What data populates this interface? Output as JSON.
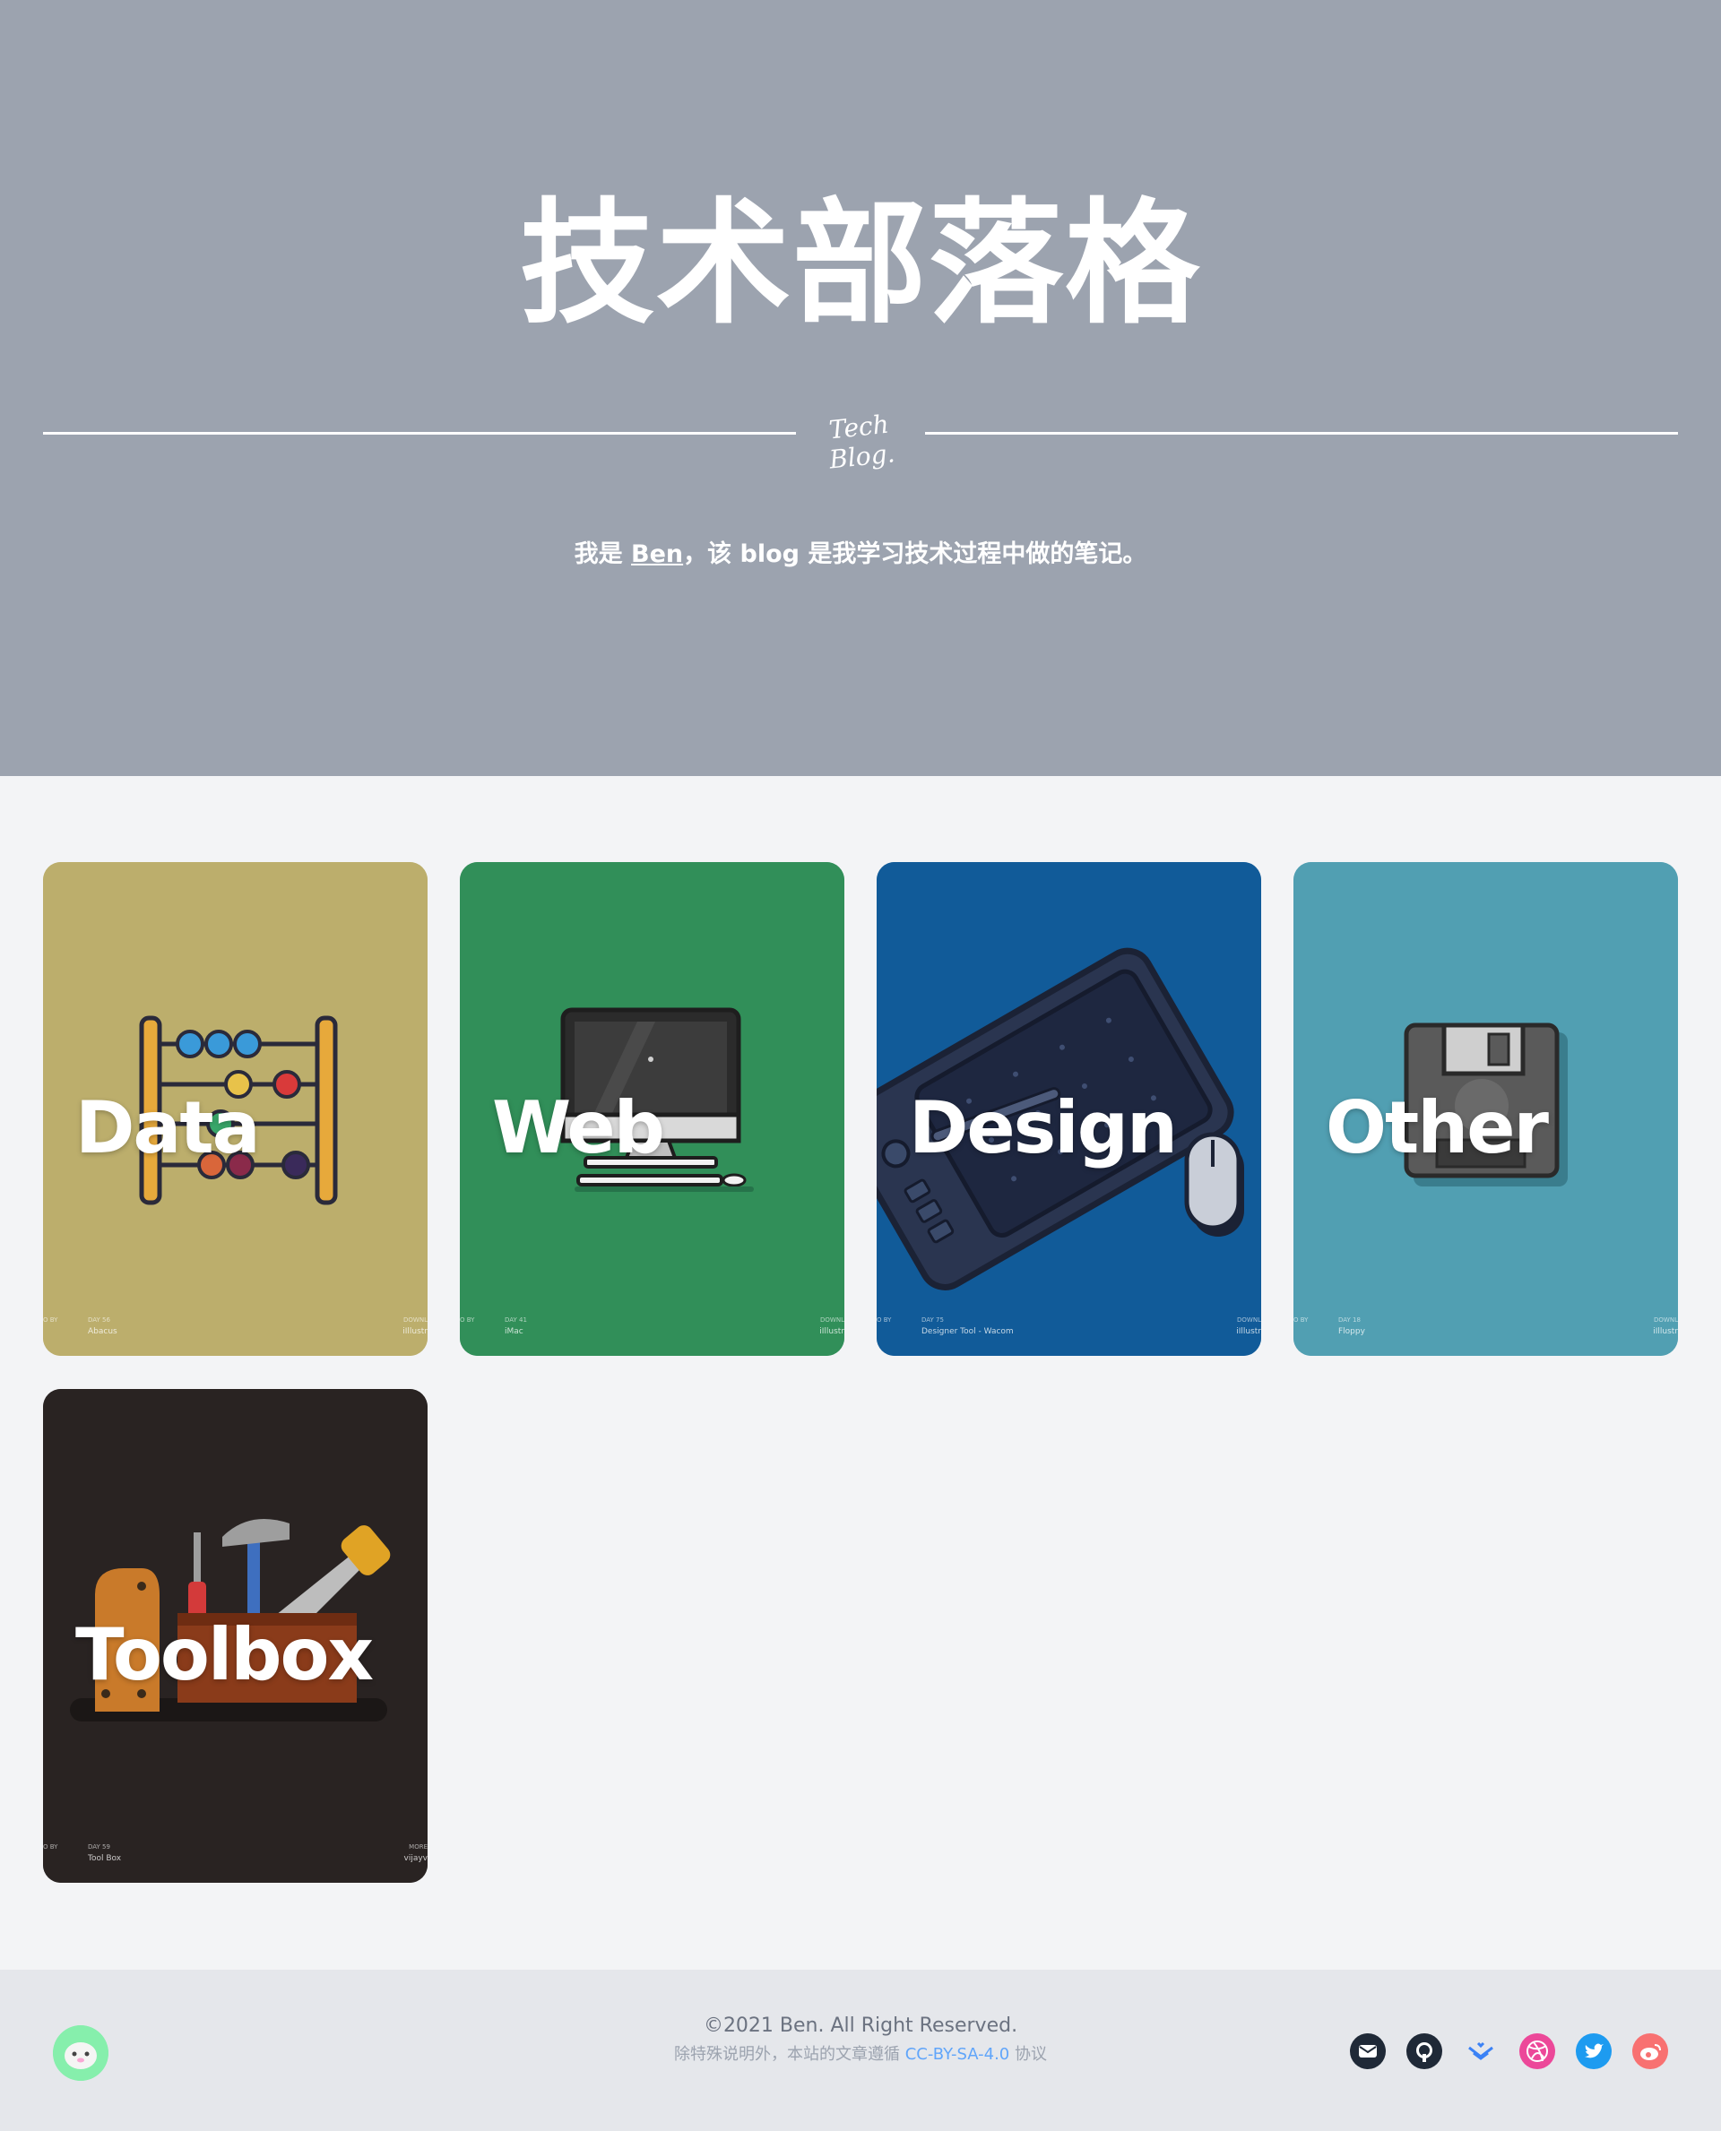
{
  "hero": {
    "title": "技术部落格",
    "mark": "Tech Blog.",
    "intro_prefix": "我是 ",
    "intro_link": "Ben",
    "intro_suffix": "，该 blog 是我学习技术过程中做的笔记。"
  },
  "cards": [
    {
      "label": "Data",
      "bg": "#bcae6c",
      "icon": "abacus-icon",
      "foot_day": "DAY 56",
      "foot_name": "Abacus",
      "foot_right_top": "DOWNL",
      "foot_right": "iIllustr",
      "foot_left": "O BY"
    },
    {
      "label": "Web",
      "bg": "#318f59",
      "icon": "imac-icon",
      "foot_day": "DAY 41",
      "foot_name": "iMac",
      "foot_right_top": "DOWNL",
      "foot_right": "iIllustr",
      "foot_left": "O BY"
    },
    {
      "label": "Design",
      "bg": "#115b99",
      "icon": "tablet-pen-icon",
      "foot_day": "DAY 75",
      "foot_name": "Designer Tool - Wacom",
      "foot_right_top": "DOWNL",
      "foot_right": "iIllustr",
      "foot_left": "O BY"
    },
    {
      "label": "Other",
      "bg": "#519fb2",
      "icon": "floppy-icon",
      "foot_day": "DAY 18",
      "foot_name": "Floppy",
      "foot_right_top": "DOWNL",
      "foot_right": "iIllustr",
      "foot_left": "O BY"
    },
    {
      "label": "Toolbox",
      "bg": "#292322",
      "icon": "toolbox-icon",
      "foot_day": "DAY 59",
      "foot_name": "Tool Box",
      "foot_right_top": "MORE",
      "foot_right": "vijayv",
      "foot_left": "O BY"
    }
  ],
  "footer": {
    "copyright": "©2021 Ben. All Right Reserved.",
    "license_prefix": "除特殊说明外，本站的文章遵循 ",
    "license_link": "CC-BY-SA-4.0",
    "license_suffix": " 协议",
    "social": [
      {
        "icon": "mail-icon",
        "color": "#1f2937"
      },
      {
        "icon": "github-icon",
        "color": "#1f2937"
      },
      {
        "icon": "juejin-icon",
        "color": "#3b82f6"
      },
      {
        "icon": "dribbble-icon",
        "color": "#ec4899"
      },
      {
        "icon": "twitter-icon",
        "color": "#1d9bf0"
      },
      {
        "icon": "weibo-icon",
        "color": "#f87171"
      }
    ]
  }
}
